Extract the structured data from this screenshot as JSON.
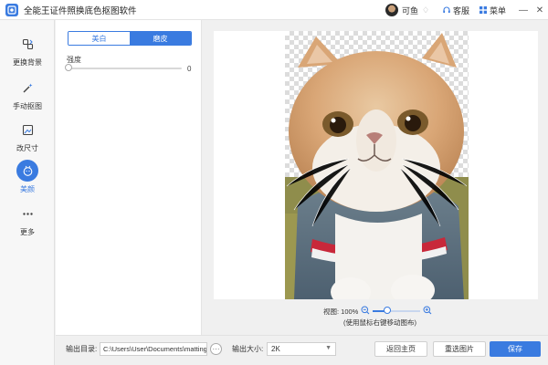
{
  "window": {
    "title": "全能王证件照换底色抠图软件",
    "user_name": "可鱼",
    "service_label": "客服",
    "menu_label": "菜单",
    "minimize_glyph": "—",
    "close_glyph": "✕"
  },
  "sidebar": {
    "items": [
      {
        "label": "更换背景",
        "icon": "swap-background-icon"
      },
      {
        "label": "手动抠图",
        "icon": "magic-wand-icon"
      },
      {
        "label": "改尺寸",
        "icon": "resize-image-icon"
      },
      {
        "label": "美颜",
        "icon": "beauty-face-icon",
        "active": true
      },
      {
        "label": "更多",
        "icon": "more-dots-icon"
      }
    ]
  },
  "panel": {
    "tabs": [
      {
        "label": "美白",
        "active": false
      },
      {
        "label": "磨皮",
        "active": true
      }
    ],
    "strength_label": "强度",
    "strength_value": "0",
    "strength_fraction": 0
  },
  "preview": {
    "zoom_label": "视图: 100%",
    "zoom_fraction": 0.3,
    "hint": "(使用鼠标右键移动图布)"
  },
  "bottom": {
    "output_dir_label": "输出目录:",
    "output_dir_value": "C:\\Users\\User\\Documents\\matting_",
    "browse_label": "···",
    "output_size_label": "输出大小:",
    "output_size_value": "2K",
    "home_button": "返回主页",
    "reselect_button": "重选图片",
    "save_button": "保存"
  },
  "colors": {
    "accent": "#3a7be0"
  }
}
